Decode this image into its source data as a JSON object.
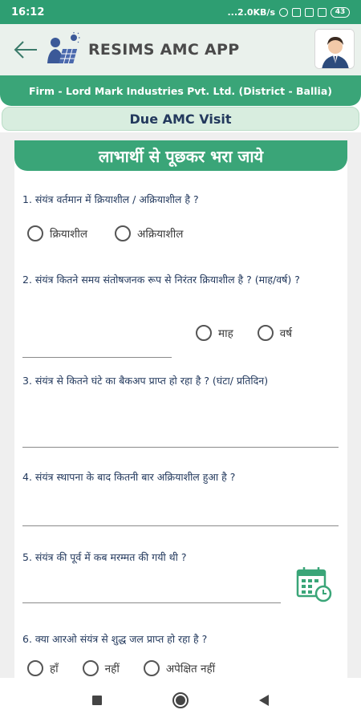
{
  "status_bar": {
    "time": "16:12",
    "network_speed": "...2.0KB/s",
    "battery": "43"
  },
  "app_bar": {
    "title": "RESIMS AMC APP",
    "back_icon": "back-arrow-icon",
    "logo_icon": "solar-technician-logo",
    "avatar_icon": "user-avatar"
  },
  "firm_bar": {
    "text": "Firm - Lord Mark Industries Pvt. Ltd. (District - Ballia)"
  },
  "due_pill": {
    "text": "Due AMC Visit"
  },
  "card": {
    "header": "लाभार्थी से पूछकर भरा जाये",
    "questions": [
      {
        "text": "1. संयंत्र वर्तमान में क्रियाशील / अक्रियाशील है ?",
        "options": [
          "क्रियाशील",
          "अक्रियाशील"
        ]
      },
      {
        "text": "2. संयंत्र कितने समय संतोषजनक रूप से निरंतर क्रियाशील है ? (माह/वर्ष) ?",
        "options": [
          "माह",
          "वर्ष"
        ]
      },
      {
        "text": "3. संयंत्र से कितने घंटे का बैकअप प्राप्त हो रहा है ? (घंटा/ प्रतिदिन)"
      },
      {
        "text": "4. संयंत्र स्थापना के बाद कितनी बार अक्रियाशील हुआ है ?"
      },
      {
        "text": "5. संयंत्र की पूर्व में कब मरम्मत की गयी थी ?"
      },
      {
        "text": "6. क्या आरओ संयंत्र से शुद्ध जल प्राप्त हो रहा है ?",
        "options": [
          "हाँ",
          "नहीं",
          "अपेक्षित नहीं"
        ]
      }
    ]
  },
  "nav_bar": {
    "icons": [
      "recents-icon",
      "home-icon",
      "back-icon"
    ]
  },
  "colors": {
    "primary": "#3aa578",
    "status": "#2e9e72",
    "text_dark": "#23395d"
  }
}
